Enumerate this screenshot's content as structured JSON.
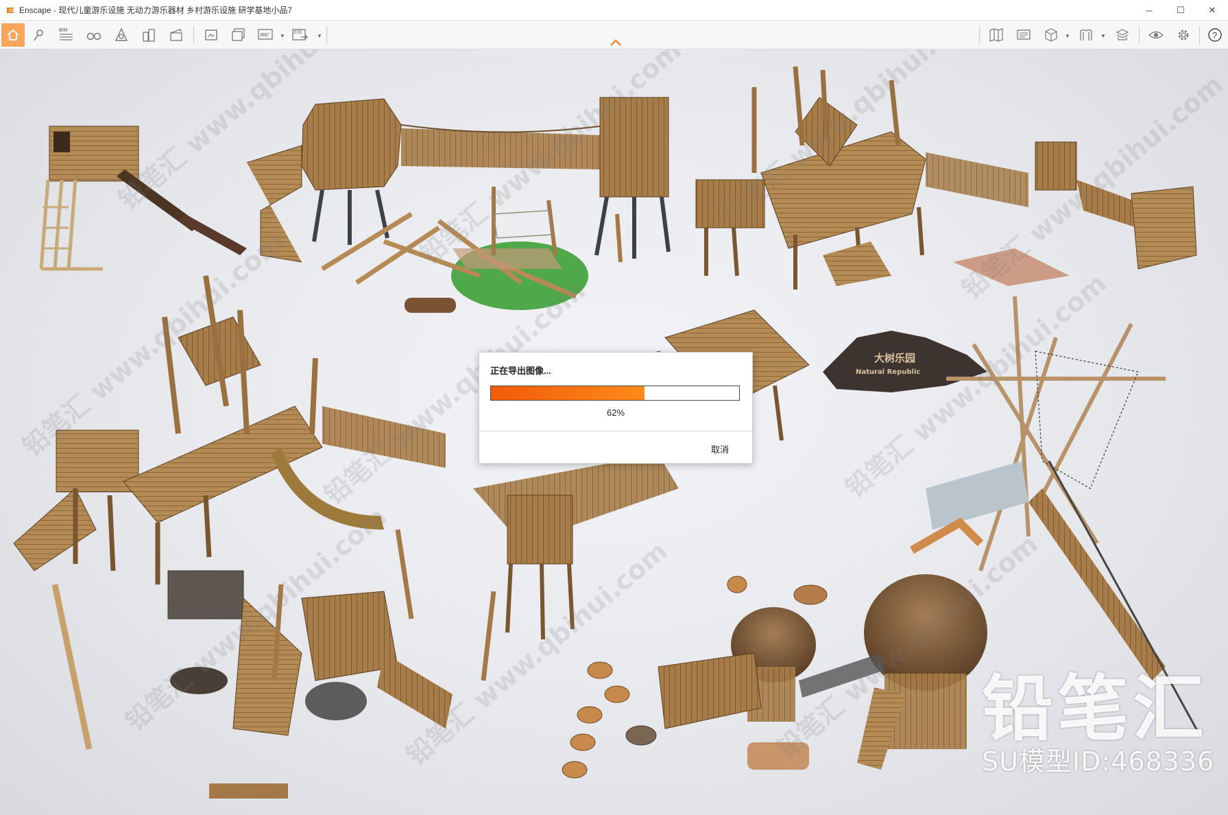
{
  "window": {
    "title": "Enscape - 现代儿童游乐设施 无动力游乐器材 乡村游乐设施 研学基地小品7",
    "minimize_glyph": "─",
    "maximize_glyph": "☐",
    "close_glyph": "✕"
  },
  "toolbar": {
    "bim_label": "BIM",
    "pano_label": "360°",
    "exe_label": "EXE",
    "icons": [
      "home-icon",
      "map-pin-icon",
      "bim-list-icon",
      "binoculars-icon",
      "compass-icon",
      "buildings-icon",
      "clapper-icon",
      "screenshot-icon",
      "batch-render-icon",
      "panorama-icon",
      "exe-export-icon",
      "help-circle-icon",
      "map-icon",
      "display-icon",
      "cube-icon",
      "bookmark-icon",
      "asset-library-icon",
      "eye-icon",
      "gear-icon",
      "question-icon"
    ]
  },
  "export_dialog": {
    "title": "正在导出图像...",
    "progress_percent": 62,
    "progress_text": "62%",
    "cancel_label": "取消"
  },
  "scene": {
    "watermark_text": "铅笔汇 www.qbihui.com",
    "brand_name": "铅笔汇",
    "brand_id": "SU模型ID:468336",
    "sign_text_cn": "大树乐园",
    "sign_text_en": "Natural Republic"
  },
  "colors": {
    "accent_orange": "#f8a65c",
    "progress_start": "#f25a08",
    "progress_end": "#ff8a1a",
    "wood": "#a87c48",
    "wood_dark": "#6f4f2a",
    "grass": "#4fa84a"
  }
}
